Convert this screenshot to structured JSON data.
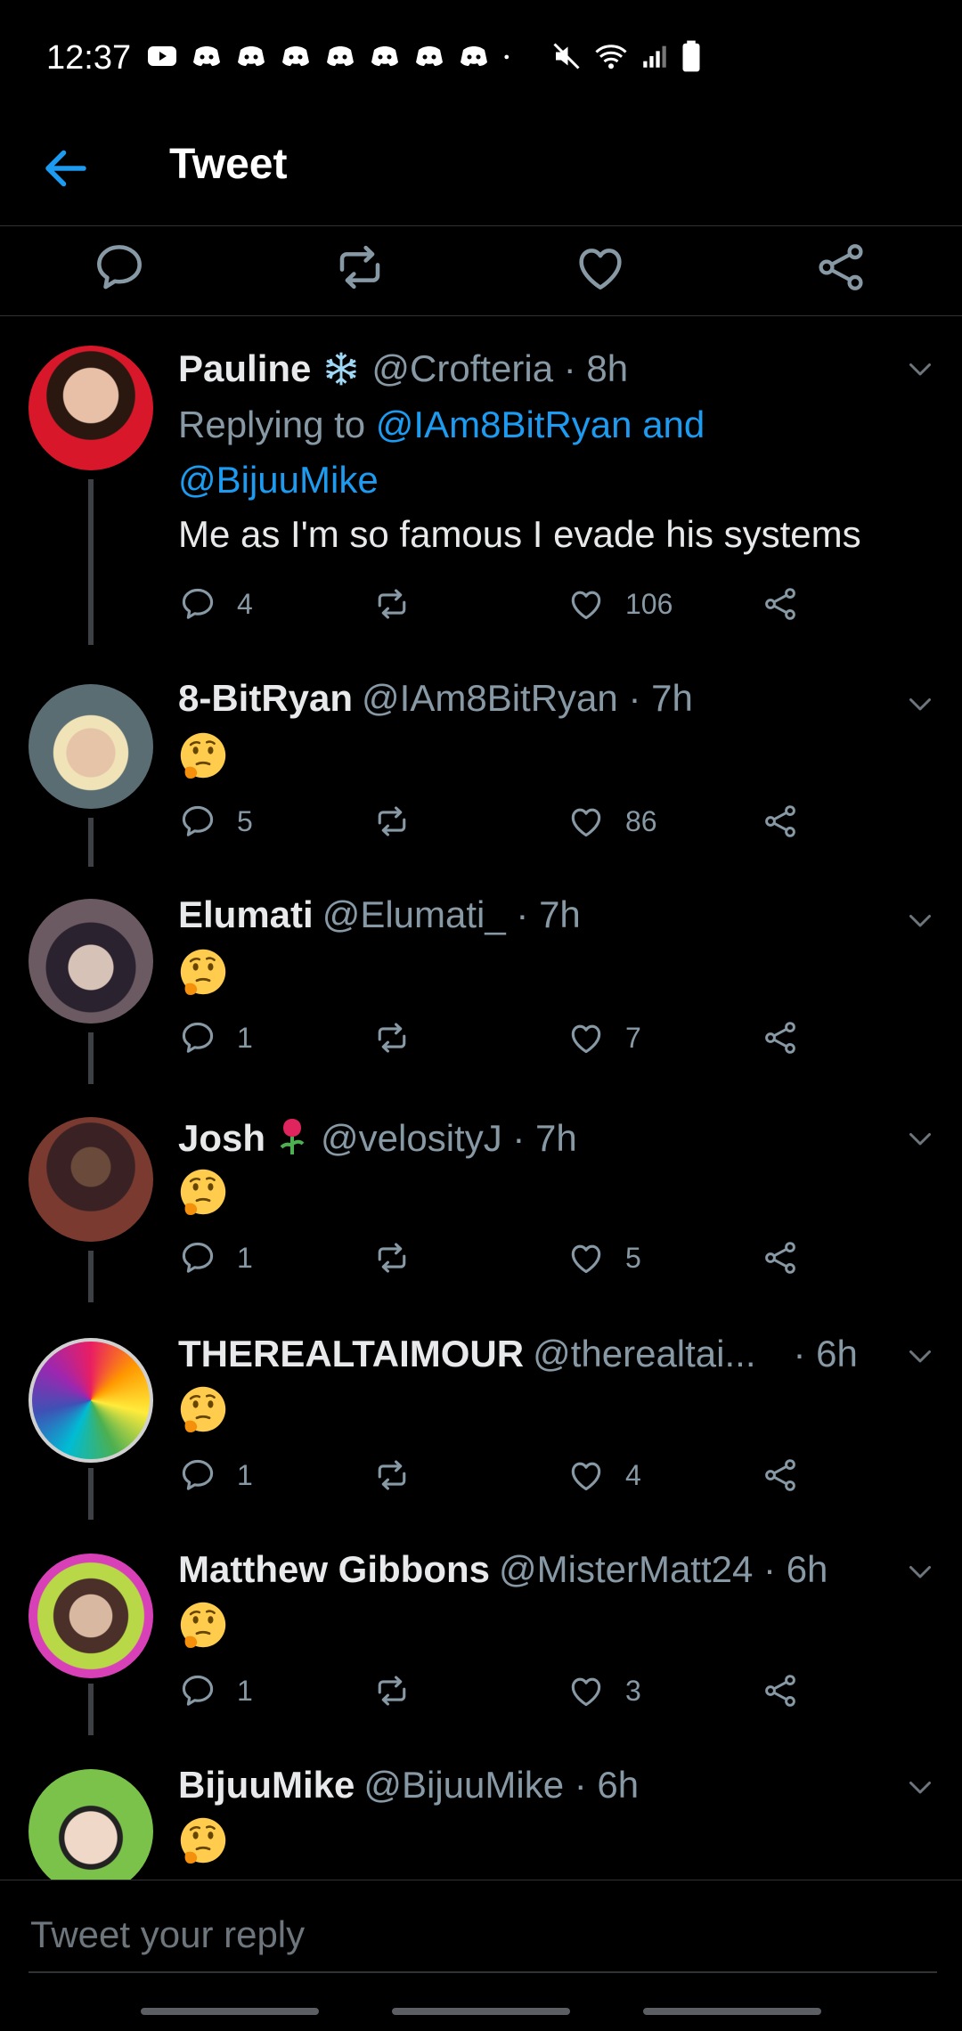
{
  "status_bar": {
    "time": "12:37"
  },
  "header": {
    "title": "Tweet"
  },
  "tweets": [
    {
      "name": "Pauline",
      "handle": "@Crofteria",
      "time": "· 8h",
      "reply_prefix": "Replying to ",
      "reply_to_line1": "@IAm8BitRyan and",
      "reply_to_line2": "@BijuuMike",
      "text": "Me as I'm so famous I evade his systems",
      "replies": "4",
      "retweets": "",
      "likes": "106"
    },
    {
      "name": "8-BitRyan",
      "handle": "@IAm8BitRyan",
      "time": "· 7h",
      "replies": "5",
      "retweets": "",
      "likes": "86"
    },
    {
      "name": "Elumati",
      "handle": "@Elumati_",
      "time": "· 7h",
      "replies": "1",
      "retweets": "",
      "likes": "7"
    },
    {
      "name": "Josh",
      "handle": "@velosityJ",
      "time": "· 7h",
      "replies": "1",
      "retweets": "",
      "likes": "5"
    },
    {
      "name": "THEREALTAIMOUR",
      "handle": "@therealtai...",
      "time": "· 6h",
      "replies": "1",
      "retweets": "",
      "likes": "4"
    },
    {
      "name": "Matthew Gibbons",
      "handle": "@MisterMatt24",
      "time": "· 6h",
      "replies": "1",
      "retweets": "",
      "likes": "3"
    },
    {
      "name": "BijuuMike",
      "handle": "@BijuuMike",
      "time": "· 6h"
    }
  ],
  "reply_box": {
    "placeholder": "Tweet your reply"
  },
  "icons": {
    "back": "arrow-left-icon",
    "reply": "reply-icon",
    "retweet": "retweet-icon",
    "like": "heart-icon",
    "share": "share-icon",
    "more": "chevron-down-icon",
    "emoji": "thinking-face-emoji"
  },
  "colors": {
    "accent": "#1d9bf0",
    "background": "#000000",
    "muted": "#8899a6"
  }
}
